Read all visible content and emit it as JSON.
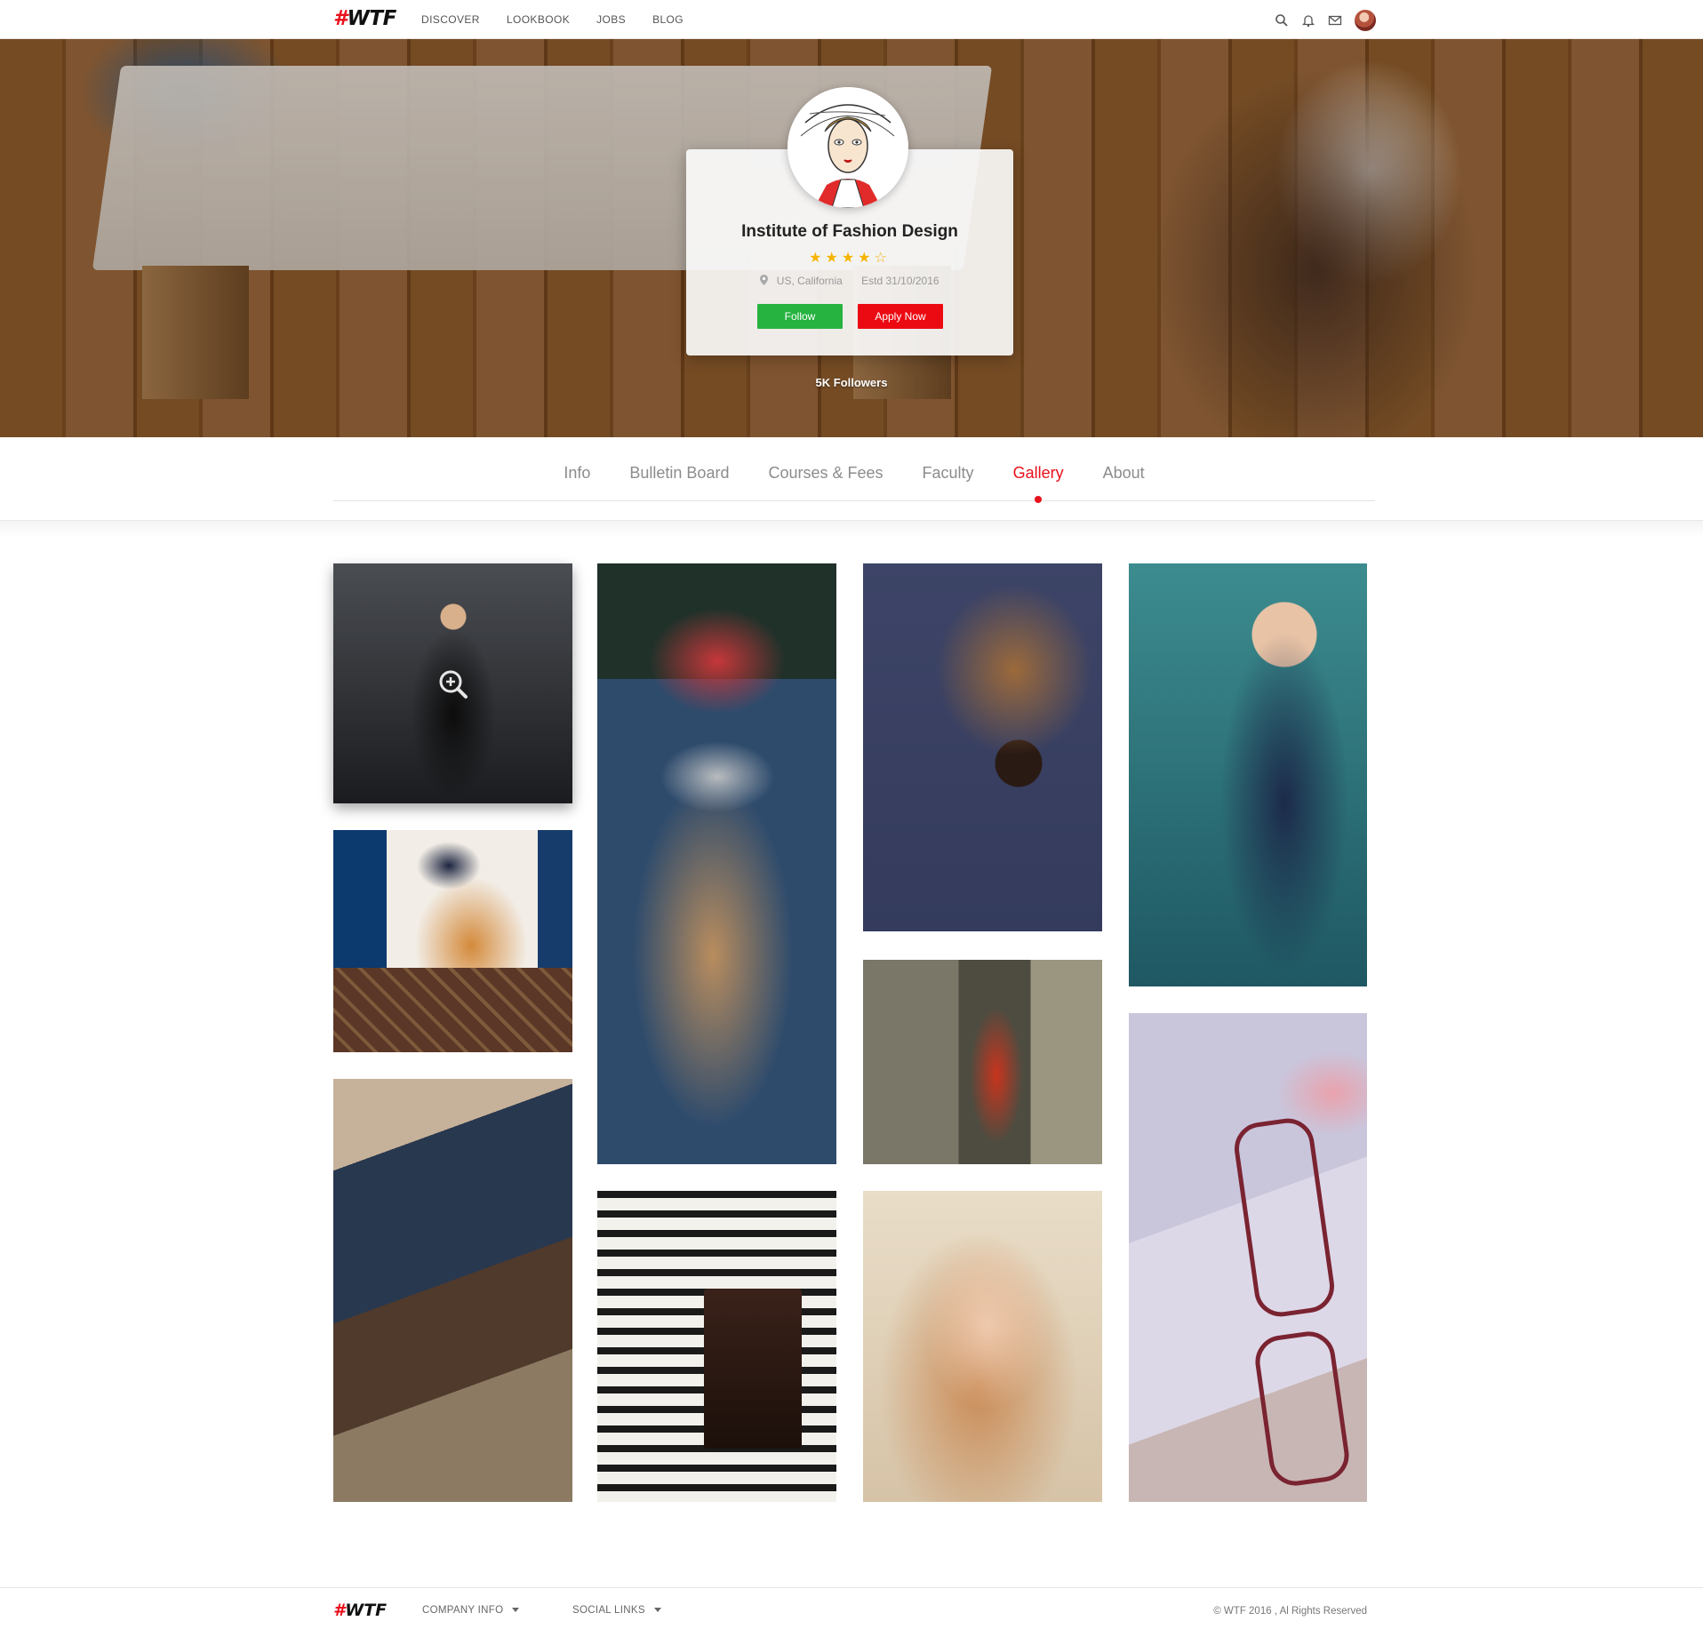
{
  "brand": {
    "logo_hash": "#",
    "logo_text": "WTF"
  },
  "nav": {
    "items": [
      {
        "label": "DISCOVER"
      },
      {
        "label": "LOOKBOOK"
      },
      {
        "label": "JOBS"
      },
      {
        "label": "BLOG"
      }
    ],
    "icons": [
      "search-icon",
      "bell-icon",
      "mail-icon",
      "user-avatar"
    ]
  },
  "profile": {
    "name": "Institute of Fashion Design",
    "rating": 4,
    "rating_max": 5,
    "stars": "★★★★☆",
    "location": "US, California",
    "established": "Estd 31/10/2016",
    "follow_label": "Follow",
    "apply_label": "Apply Now",
    "followers": "5K Followers"
  },
  "tabs": [
    {
      "label": "Info",
      "active": false
    },
    {
      "label": "Bulletin Board",
      "active": false
    },
    {
      "label": "Courses & Fees",
      "active": false
    },
    {
      "label": "Faculty",
      "active": false
    },
    {
      "label": "Gallery",
      "active": true
    },
    {
      "label": "About",
      "active": false
    }
  ],
  "gallery": {
    "images": [
      {
        "name": "model-black-dress"
      },
      {
        "name": "hand-with-bag"
      },
      {
        "name": "jeans-boots"
      },
      {
        "name": "girl-with-camera"
      },
      {
        "name": "striped-shirt-bag"
      },
      {
        "name": "leather-bag-accessories"
      },
      {
        "name": "red-dress-model"
      },
      {
        "name": "blonde-portrait"
      },
      {
        "name": "model-blue-dress"
      },
      {
        "name": "eyeglasses-pink"
      }
    ],
    "hover_icon": "zoom-in-icon"
  },
  "footer": {
    "logo_hash": "#",
    "logo_text": "WTF",
    "company_info": "COMPANY INFO",
    "social_links": "SOCIAL LINKS",
    "copyright": "© WTF 2016 , Al Rights Reserved"
  },
  "colors": {
    "accent": "#e8101c",
    "follow_button": "#26b340",
    "apply_button": "#ec0a12",
    "star": "#f6b400"
  }
}
